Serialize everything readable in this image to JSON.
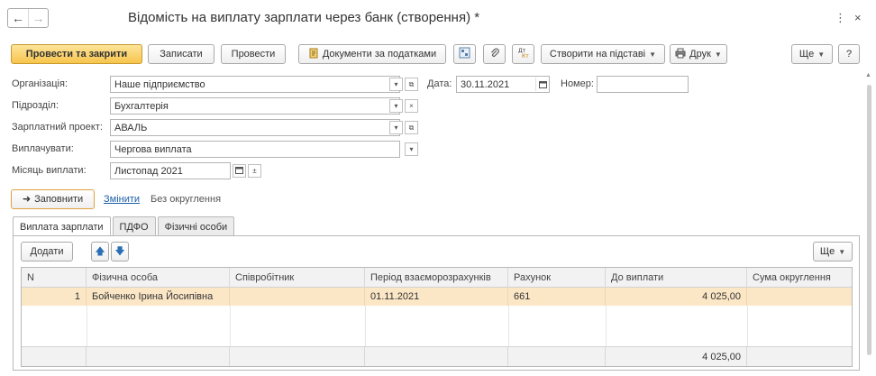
{
  "window": {
    "title": "Відомість на виплату зарплати через банк (створення) *",
    "more_icon": "⋮",
    "close_icon": "×"
  },
  "nav": {
    "back": "←",
    "forward": "→"
  },
  "toolbar": {
    "post_close": "Провести та закрити",
    "save": "Записати",
    "post": "Провести",
    "tax_docs": "Документи за податками",
    "create_based": "Створити на підставі",
    "print": "Друк",
    "more": "Ще",
    "help": "?"
  },
  "form": {
    "org_label": "Організація:",
    "org_value": "Наше підприємство",
    "date_label": "Дата:",
    "date_value": "30.11.2021",
    "number_label": "Номер:",
    "number_value": "",
    "dept_label": "Підрозділ:",
    "dept_value": "Бухгалтерія",
    "project_label": "Зарплатний проект:",
    "project_value": "АВАЛЬ",
    "pay_label": "Виплачувати:",
    "pay_value": "Чергова виплата",
    "month_label": "Місяць виплати:",
    "month_value": "Листопад 2021"
  },
  "fill": {
    "fill_button": "Заповнити",
    "change_link": "Змінити",
    "rounding_text": "Без округлення"
  },
  "tabs": [
    {
      "label": "Виплата зарплати"
    },
    {
      "label": "ПДФО"
    },
    {
      "label": "Фізичні особи"
    }
  ],
  "table_toolbar": {
    "add": "Додати",
    "more": "Ще"
  },
  "table": {
    "columns": [
      "N",
      "Фізична особа",
      "Співробітник",
      "Період взаєморозрахунків",
      "Рахунок",
      "До виплати",
      "Сума округлення"
    ],
    "rows": [
      {
        "n": "1",
        "person": "Бойченко Ірина Йосипівна",
        "employee": "",
        "period": "01.11.2021",
        "account": "661",
        "amount": "4 025,00",
        "rounding": ""
      }
    ],
    "total_amount": "4 025,00"
  },
  "colors": {
    "primary": "#f7c54d",
    "selected_row": "#fbe7c6",
    "link": "#1a5fa8"
  }
}
